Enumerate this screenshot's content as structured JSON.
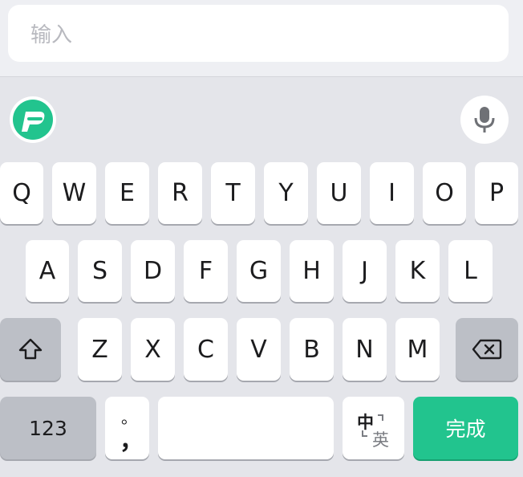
{
  "input": {
    "placeholder": "输入"
  },
  "rows": {
    "row1": [
      "Q",
      "W",
      "E",
      "R",
      "T",
      "Y",
      "U",
      "I",
      "O",
      "P"
    ],
    "row2": [
      "A",
      "S",
      "D",
      "F",
      "G",
      "H",
      "J",
      "K",
      "L"
    ],
    "row3": [
      "Z",
      "X",
      "C",
      "V",
      "B",
      "N",
      "M"
    ]
  },
  "bottom": {
    "numbers_label": "123",
    "punct_top": "。",
    "punct_bottom": "，",
    "lang_top": "中",
    "lang_bottom": "英",
    "done_label": "完成"
  },
  "icons": {
    "logo": "app-logo-icon",
    "mic": "microphone-icon",
    "shift": "shift-icon",
    "delete": "backspace-icon"
  },
  "colors": {
    "accent": "#22c48e",
    "keyboard_bg": "#e4e5ea",
    "key_bg": "#ffffff",
    "function_key_bg": "#bcbfc6"
  }
}
